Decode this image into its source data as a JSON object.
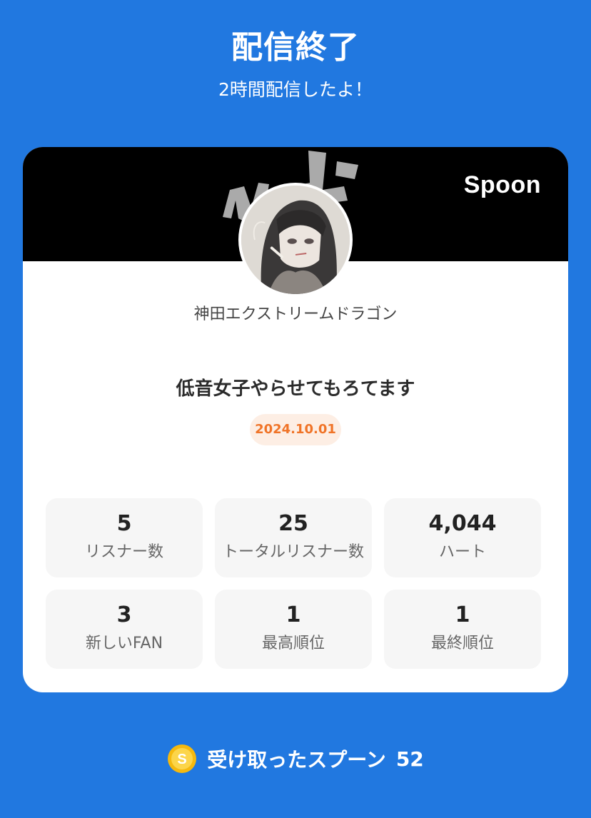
{
  "header": {
    "title": "配信終了",
    "subtitle": "2時間配信したよ！"
  },
  "card": {
    "brand": "Spoon",
    "dj_name": "神田エクストリームドラゴン",
    "live_title": "低音女子やらせてもろてます",
    "date": "2024.10.01",
    "stats": [
      {
        "value": "5",
        "label": "リスナー数"
      },
      {
        "value": "25",
        "label": "トータルリスナー数"
      },
      {
        "value": "4,044",
        "label": "ハート"
      },
      {
        "value": "3",
        "label": "新しいFAN"
      },
      {
        "value": "1",
        "label": "最高順位"
      },
      {
        "value": "1",
        "label": "最終順位"
      }
    ]
  },
  "footer": {
    "spoons_label": "受け取ったスプーン",
    "spoons_count": "52",
    "coin_icon": "spoon-coin-icon"
  },
  "colors": {
    "background": "#2178e0",
    "badge_text": "#f07428",
    "badge_bg": "#fdeee4",
    "coin": "#f5b90f"
  }
}
